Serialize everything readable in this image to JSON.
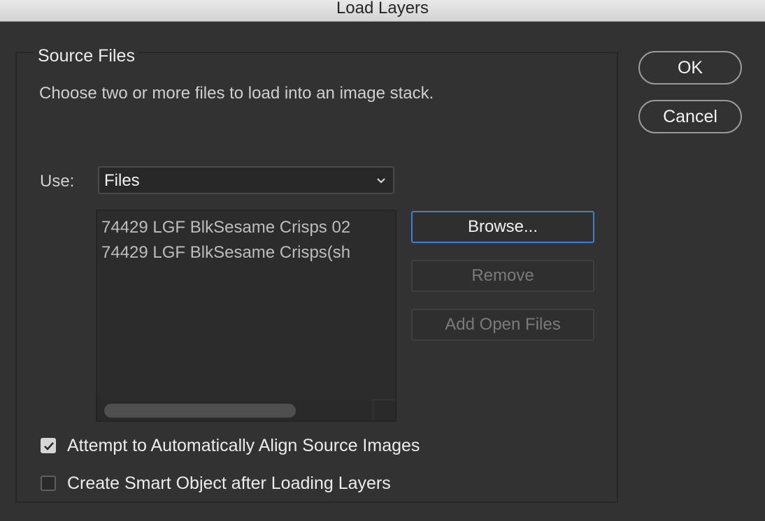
{
  "window": {
    "title": "Load Layers"
  },
  "source_files": {
    "group_label": "Source Files",
    "instructions": "Choose two or more files to load into an image stack.",
    "use_label": "Use:",
    "use_value": "Files",
    "files": [
      "74429 LGF BlkSesame Crisps 02",
      "74429 LGF BlkSesame Crisps(sh"
    ],
    "browse_label": "Browse...",
    "remove_label": "Remove",
    "add_open_files_label": "Add Open Files"
  },
  "options": {
    "align_label": "Attempt to Automatically Align Source Images",
    "align_checked": true,
    "smart_object_label": "Create Smart Object after Loading Layers",
    "smart_object_checked": false
  },
  "actions": {
    "ok_label": "OK",
    "cancel_label": "Cancel"
  },
  "colors": {
    "background": "#323232",
    "focus_ring": "#3d7fd1"
  },
  "icons": {
    "dropdown": "chevron-down-icon",
    "checked": "checkmark-icon"
  }
}
